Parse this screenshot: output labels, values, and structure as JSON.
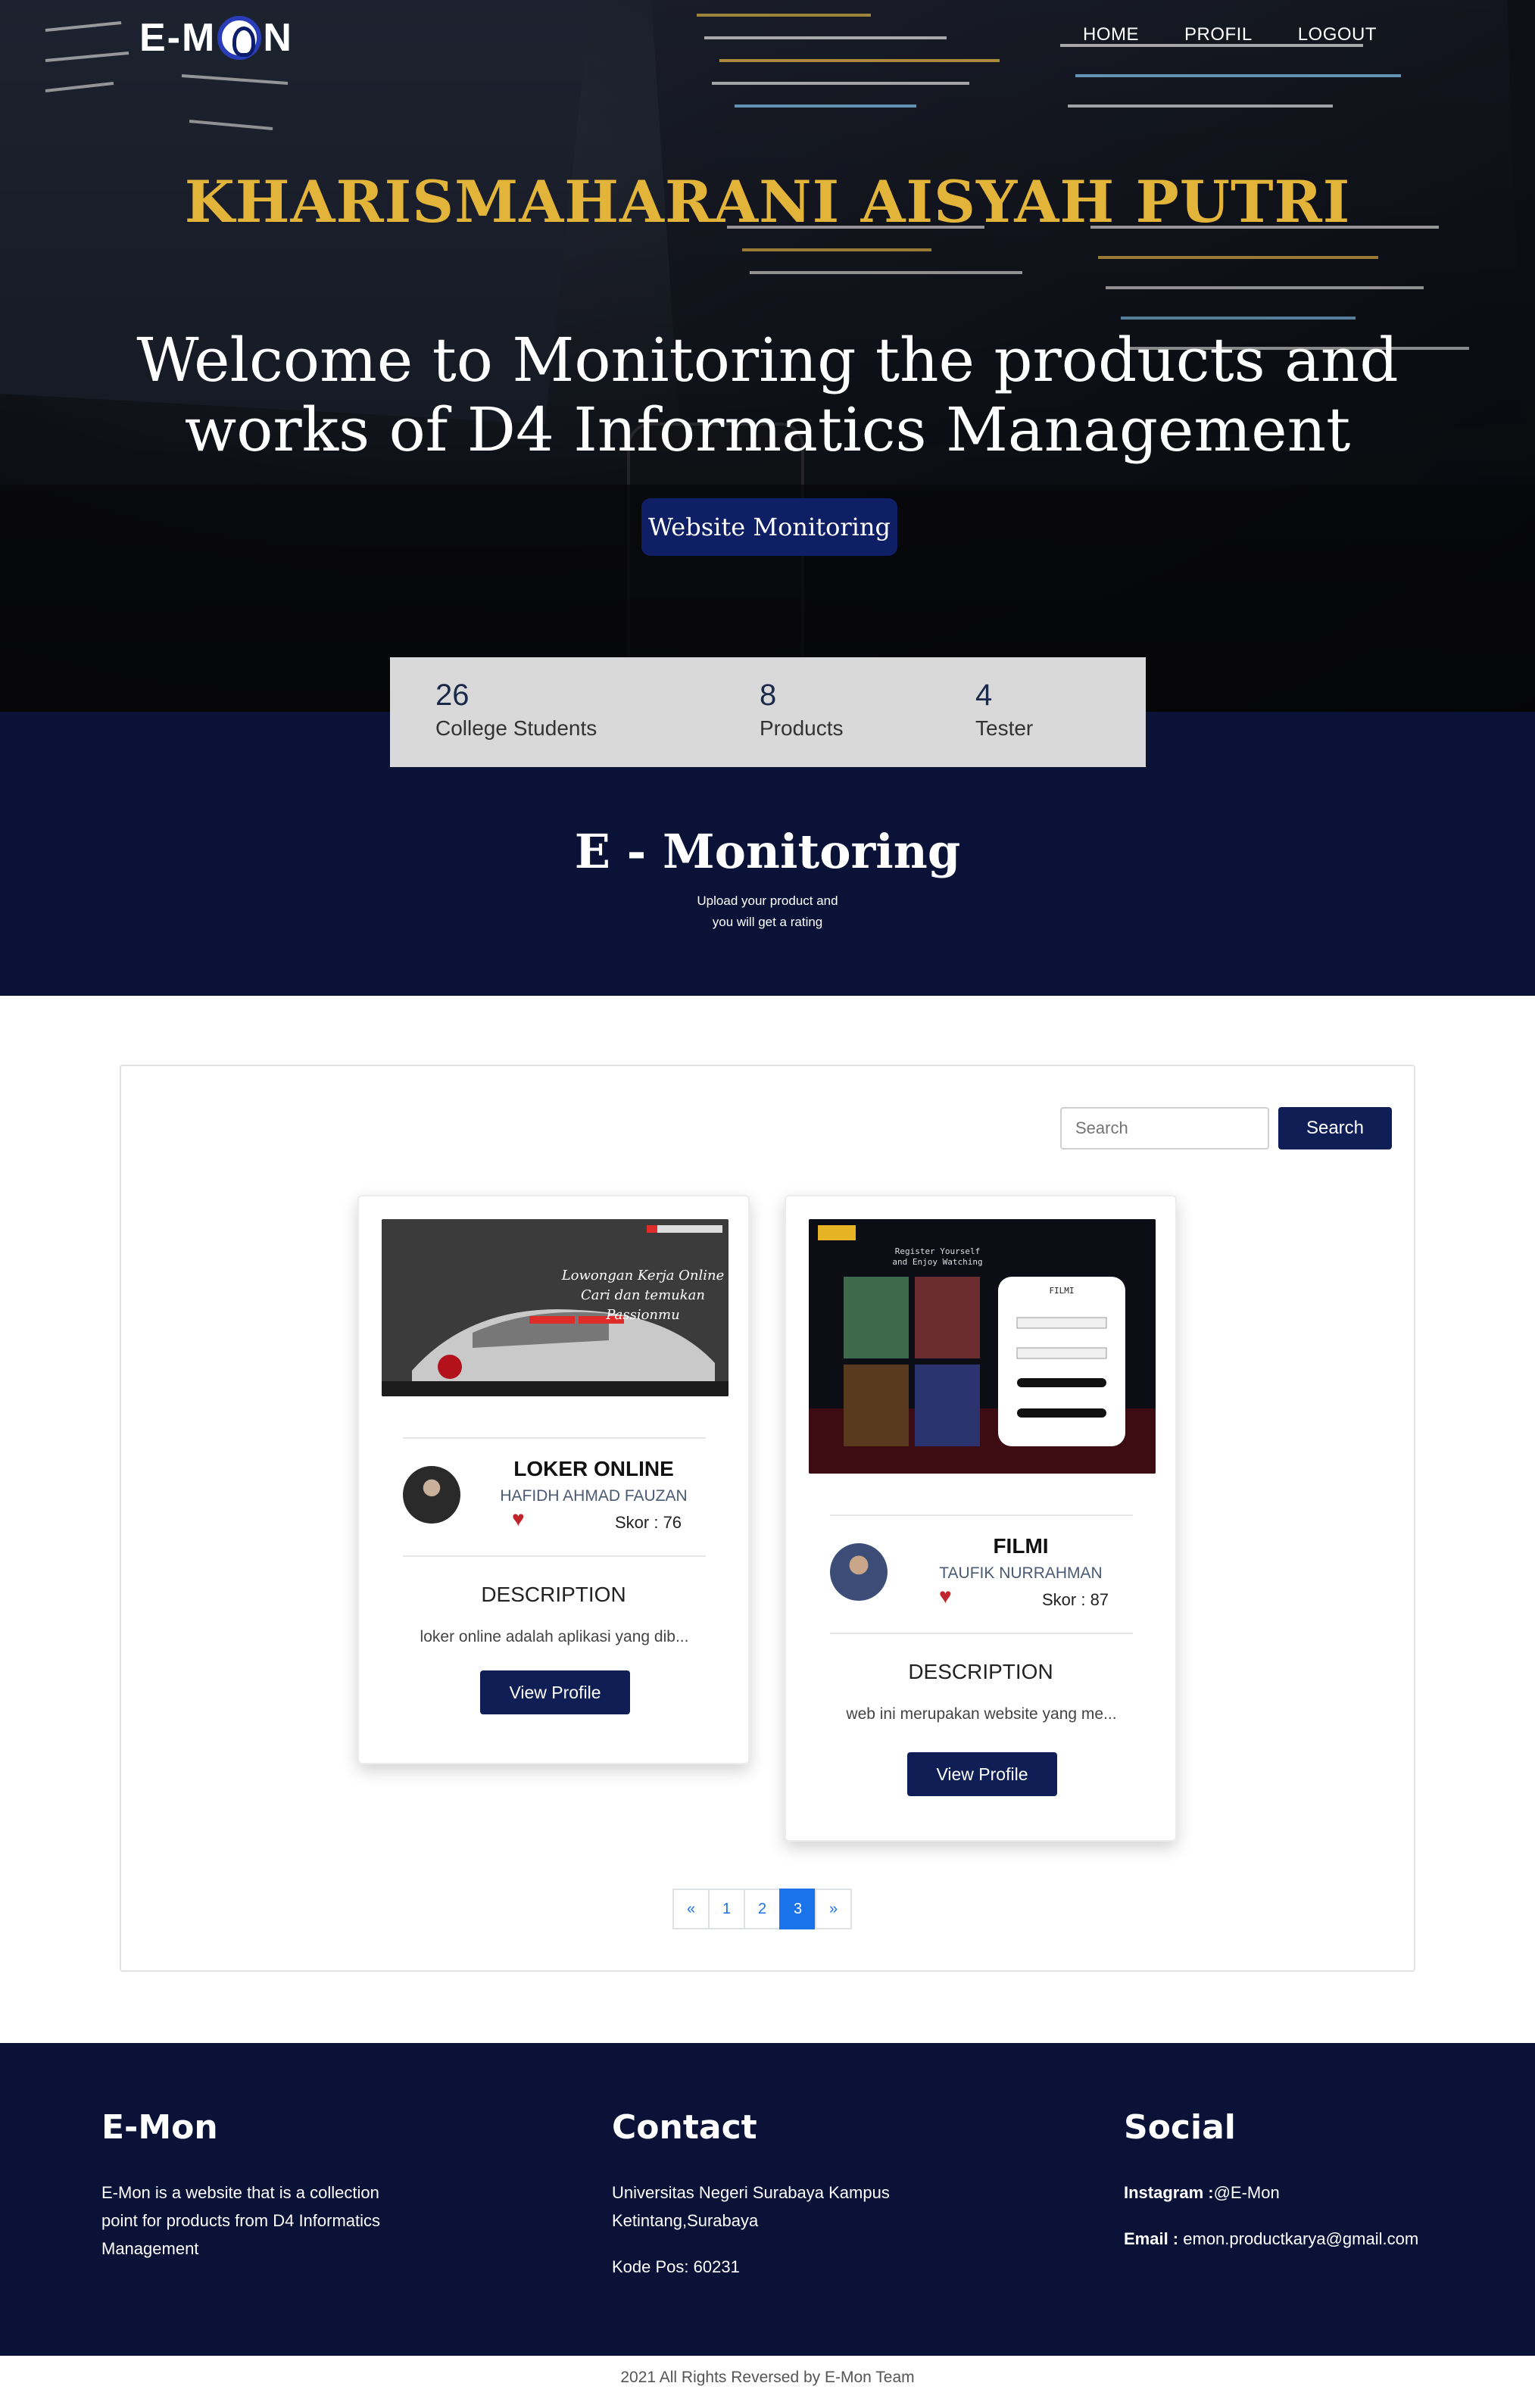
{
  "brand": {
    "logo_text_left": "E-M",
    "logo_text_right": "N"
  },
  "nav": {
    "items": [
      "HOME",
      "PROFIL",
      "LOGOUT"
    ]
  },
  "hero": {
    "name": "KHARISMAHARANI AISYAH PUTRI",
    "title": "Welcome to Monitoring the products and works of D4 Informatics Management",
    "button": "Website Monitoring"
  },
  "stats": [
    {
      "value": "26",
      "label": "College Students"
    },
    {
      "value": "8",
      "label": "Products"
    },
    {
      "value": "4",
      "label": "Tester"
    }
  ],
  "section": {
    "title": "E - Monitoring",
    "subtitle_line1": "Upload your product and",
    "subtitle_line2": "you will get a rating"
  },
  "search": {
    "placeholder": "Search",
    "button": "Search"
  },
  "cards": [
    {
      "title": "LOKER ONLINE",
      "author": "HAFIDH AHMAD FAUZAN",
      "score": "Skor : 76",
      "desc_heading": "DESCRIPTION",
      "desc": "loker online adalah aplikasi yang dib...",
      "button": "View Profile",
      "thumb_text_1": "Lowongan Kerja Online",
      "thumb_text_2": "Cari dan temukan Passionmu"
    },
    {
      "title": "FILMI",
      "author": "TAUFIK NURRAHMAN",
      "score": "Skor : 87",
      "desc_heading": "DESCRIPTION",
      "desc": "web ini merupakan website yang me...",
      "button": "View Profile",
      "thumb_text_1": "Register Yourself",
      "thumb_text_2": "and Enjoy Watching",
      "thumb_form_title": "FILMI"
    }
  ],
  "pagination": {
    "prev": "«",
    "pages": [
      "1",
      "2",
      "3"
    ],
    "active": "3",
    "next": "»"
  },
  "footer": {
    "col1": {
      "title": "E-Mon",
      "text": "E-Mon is a website that is a collection point for products from D4 Informatics Management"
    },
    "col2": {
      "title": "Contact",
      "address": "Universitas Negeri Surabaya Kampus Ketintang,Surabaya",
      "postal": "Kode Pos: 60231"
    },
    "col3": {
      "title": "Social",
      "instagram_label": "Instagram :",
      "instagram_value": "@E-Mon",
      "email_label": "Email :",
      "email_value": " emon.productkarya@gmail.com"
    },
    "copyright": "2021 All Rights Reversed by E-Mon Team"
  },
  "colors": {
    "navy": "#0a1238",
    "gold": "#e2b43a",
    "accent_blue": "#1a73e8",
    "heart": "#c0242c"
  }
}
